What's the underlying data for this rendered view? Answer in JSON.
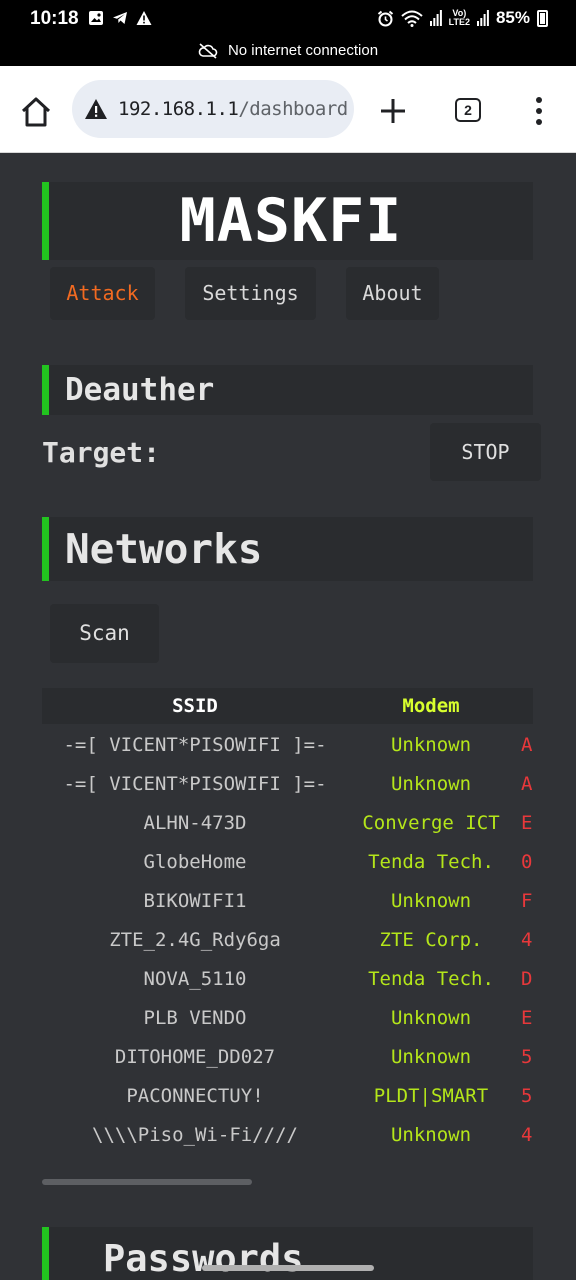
{
  "status_bar": {
    "time": "10:18",
    "lte_label_top": "Vo)",
    "lte_label_bottom": "LTE2",
    "battery": "85%",
    "network_notice": "No internet connection"
  },
  "browser": {
    "url_host": "192.168.1.1",
    "url_path": "/dashboard",
    "tab_count": "2"
  },
  "app": {
    "brand": "MASKFI",
    "nav": {
      "attack": "Attack",
      "settings": "Settings",
      "about": "About"
    },
    "deauther": {
      "title": "Deauther",
      "target_label": "Target:",
      "stop_label": "STOP"
    },
    "networks": {
      "title": "Networks",
      "scan_label": "Scan",
      "columns": {
        "ssid": "SSID",
        "modem": "Modem"
      },
      "rows": [
        {
          "ssid": "-=[ VICENT*PISOWIFI ]=-",
          "modem": "Unknown",
          "extra": "A"
        },
        {
          "ssid": "-=[ VICENT*PISOWIFI ]=-",
          "modem": "Unknown",
          "extra": "A"
        },
        {
          "ssid": "ALHN-473D",
          "modem": "Converge ICT",
          "extra": "E"
        },
        {
          "ssid": "GlobeHome",
          "modem": "Tenda Tech.",
          "extra": "0"
        },
        {
          "ssid": "BIKOWIFI1",
          "modem": "Unknown",
          "extra": "F"
        },
        {
          "ssid": "ZTE_2.4G_Rdy6ga",
          "modem": "ZTE Corp.",
          "extra": "4"
        },
        {
          "ssid": "NOVA_5110",
          "modem": "Tenda Tech.",
          "extra": "D"
        },
        {
          "ssid": "PLB VENDO",
          "modem": "Unknown",
          "extra": "E"
        },
        {
          "ssid": "DITOHOME_DD027",
          "modem": "Unknown",
          "extra": "5"
        },
        {
          "ssid": "PACONNECTUY!",
          "modem": "PLDT|SMART",
          "extra": "5"
        },
        {
          "ssid": "\\\\\\\\Piso_Wi-Fi////",
          "modem": "Unknown",
          "extra": "4"
        }
      ]
    },
    "passwords": {
      "title": "Passwords"
    }
  },
  "colors": {
    "accent_green": "#22c31f",
    "attack_orange": "#f26a21",
    "modem_header": "#d8ff2e",
    "modem_value": "#b4e61a",
    "extra_red": "#e8383b",
    "page_bg": "#303236"
  }
}
